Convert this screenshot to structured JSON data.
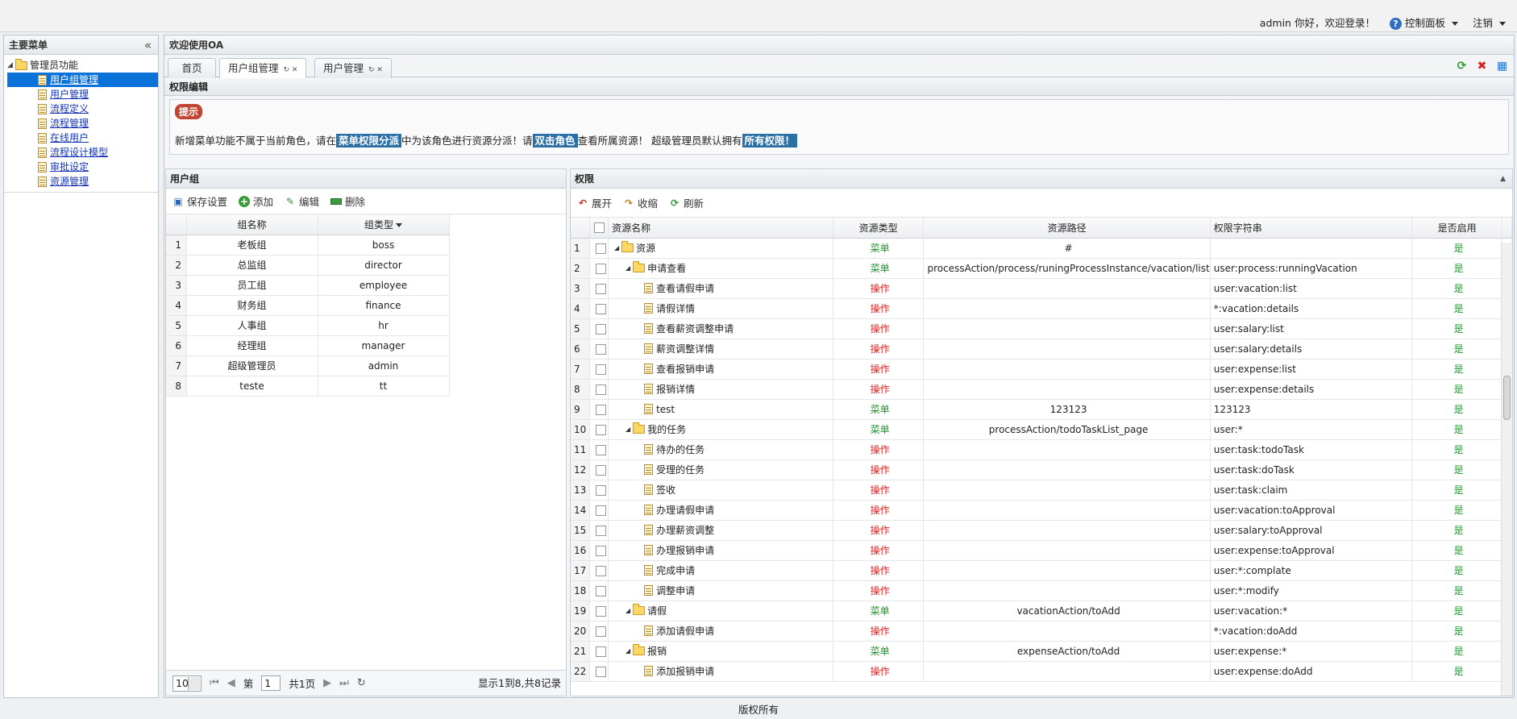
{
  "topbar": {
    "user": "admin",
    "greeting": "你好，欢迎登录！",
    "control_panel": "控制面板",
    "logout": "注销"
  },
  "sidebar": {
    "title": "主要菜单",
    "root": "管理员功能",
    "items": [
      {
        "label": "用户组管理",
        "selected": true
      },
      {
        "label": "用户管理"
      },
      {
        "label": "流程定义"
      },
      {
        "label": "流程管理"
      },
      {
        "label": "在线用户"
      },
      {
        "label": "流程设计模型"
      },
      {
        "label": "审批设定"
      },
      {
        "label": "资源管理"
      }
    ]
  },
  "main": {
    "title": "欢迎使用OA",
    "tabs": [
      {
        "label": "首页"
      },
      {
        "label": "用户组管理",
        "active": true
      },
      {
        "label": "用户管理"
      }
    ],
    "section_title": "权限编辑"
  },
  "tip": {
    "badge": "提示",
    "t1": "新增菜单功能不属于当前角色，请在",
    "h1": "菜单权限分派",
    "t2": "中为该角色进行资源分派！请",
    "h2": "双击角色",
    "t3": "查看所属资源！ 超级管理员默认拥有",
    "h3": "所有权限！"
  },
  "groups": {
    "title": "用户组",
    "toolbar": {
      "save": "保存设置",
      "add": "添加",
      "edit": "编辑",
      "delete": "删除"
    },
    "col_name": "组名称",
    "col_type": "组类型",
    "rows": [
      [
        "1",
        "老板组",
        "boss"
      ],
      [
        "2",
        "总监组",
        "director"
      ],
      [
        "3",
        "员工组",
        "employee"
      ],
      [
        "4",
        "财务组",
        "finance"
      ],
      [
        "5",
        "人事组",
        "hr"
      ],
      [
        "6",
        "经理组",
        "manager"
      ],
      [
        "7",
        "超级管理员",
        "admin"
      ],
      [
        "8",
        "teste",
        "tt"
      ]
    ],
    "pager": {
      "size": "10",
      "page_prefix": "第",
      "page": "1",
      "page_suffix": "共1页",
      "info": "显示1到8,共8记录"
    }
  },
  "perms": {
    "title": "权限",
    "toolbar": {
      "expand": "展开",
      "collapse": "收缩",
      "refresh": "刷新"
    },
    "cols": [
      "资源名称",
      "资源类型",
      "资源路径",
      "权限字符串",
      "是否启用"
    ],
    "rows": [
      [
        "1",
        1,
        "folder",
        "资源",
        "菜单",
        "#",
        "",
        "是"
      ],
      [
        "2",
        2,
        "folder",
        "申请查看",
        "菜单",
        "processAction/process/runingProcessInstance/vacation/list",
        "user:process:runningVacation",
        "是"
      ],
      [
        "3",
        3,
        "file",
        "查看请假申请",
        "操作",
        "",
        "user:vacation:list",
        "是"
      ],
      [
        "4",
        3,
        "file",
        "请假详情",
        "操作",
        "",
        "*:vacation:details",
        "是"
      ],
      [
        "5",
        3,
        "file",
        "查看薪资调整申请",
        "操作",
        "",
        "user:salary:list",
        "是"
      ],
      [
        "6",
        3,
        "file",
        "薪资调整详情",
        "操作",
        "",
        "user:salary:details",
        "是"
      ],
      [
        "7",
        3,
        "file",
        "查看报销申请",
        "操作",
        "",
        "user:expense:list",
        "是"
      ],
      [
        "8",
        3,
        "file",
        "报销详情",
        "操作",
        "",
        "user:expense:details",
        "是"
      ],
      [
        "9",
        3,
        "file",
        "test",
        "菜单",
        "123123",
        "123123",
        "是"
      ],
      [
        "10",
        2,
        "folder",
        "我的任务",
        "菜单",
        "processAction/todoTaskList_page",
        "user:*",
        "是"
      ],
      [
        "11",
        3,
        "file",
        "待办的任务",
        "操作",
        "",
        "user:task:todoTask",
        "是"
      ],
      [
        "12",
        3,
        "file",
        "受理的任务",
        "操作",
        "",
        "user:task:doTask",
        "是"
      ],
      [
        "13",
        3,
        "file",
        "签收",
        "操作",
        "",
        "user:task:claim",
        "是"
      ],
      [
        "14",
        3,
        "file",
        "办理请假申请",
        "操作",
        "",
        "user:vacation:toApproval",
        "是"
      ],
      [
        "15",
        3,
        "file",
        "办理薪资调整",
        "操作",
        "",
        "user:salary:toApproval",
        "是"
      ],
      [
        "16",
        3,
        "file",
        "办理报销申请",
        "操作",
        "",
        "user:expense:toApproval",
        "是"
      ],
      [
        "17",
        3,
        "file",
        "完成申请",
        "操作",
        "",
        "user:*:complate",
        "是"
      ],
      [
        "18",
        3,
        "file",
        "调整申请",
        "操作",
        "",
        "user:*:modify",
        "是"
      ],
      [
        "19",
        2,
        "folder",
        "请假",
        "菜单",
        "vacationAction/toAdd",
        "user:vacation:*",
        "是"
      ],
      [
        "20",
        3,
        "file",
        "添加请假申请",
        "操作",
        "",
        "*:vacation:doAdd",
        "是"
      ],
      [
        "21",
        2,
        "folder",
        "报销",
        "菜单",
        "expenseAction/toAdd",
        "user:expense:*",
        "是"
      ],
      [
        "22",
        3,
        "file",
        "添加报销申请",
        "操作",
        "",
        "user:expense:doAdd",
        "是"
      ]
    ]
  },
  "footer": "版权所有",
  "colors": {
    "menu": "#1b9b2a",
    "op": "#e02020",
    "selected": "#0a72d9",
    "highlight": "#2a6fa6",
    "badge": "#c14430"
  }
}
